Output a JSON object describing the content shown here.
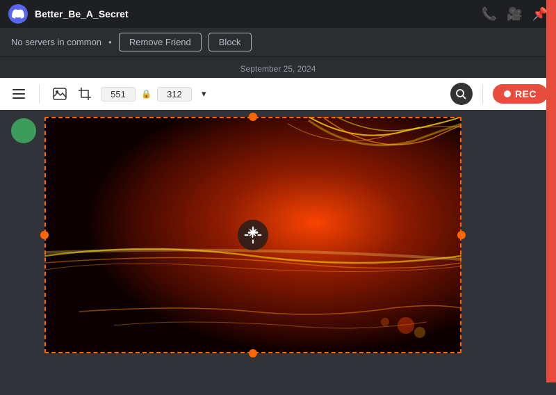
{
  "titleBar": {
    "username": "Better_Be_A_Secret",
    "icons": [
      "phone",
      "video",
      "pin"
    ]
  },
  "subheader": {
    "noServers": "No servers in common",
    "removeFriendLabel": "Remove Friend",
    "blockLabel": "Block"
  },
  "dateLabel": "September 25, 2024",
  "toolbar": {
    "widthValue": "551",
    "heightValue": "312",
    "dropdownLabel": "▾",
    "recLabel": "REC"
  },
  "colors": {
    "accent": "#e74c3c",
    "toolbar_bg": "#ffffff",
    "selection_border": "#ff6600"
  }
}
